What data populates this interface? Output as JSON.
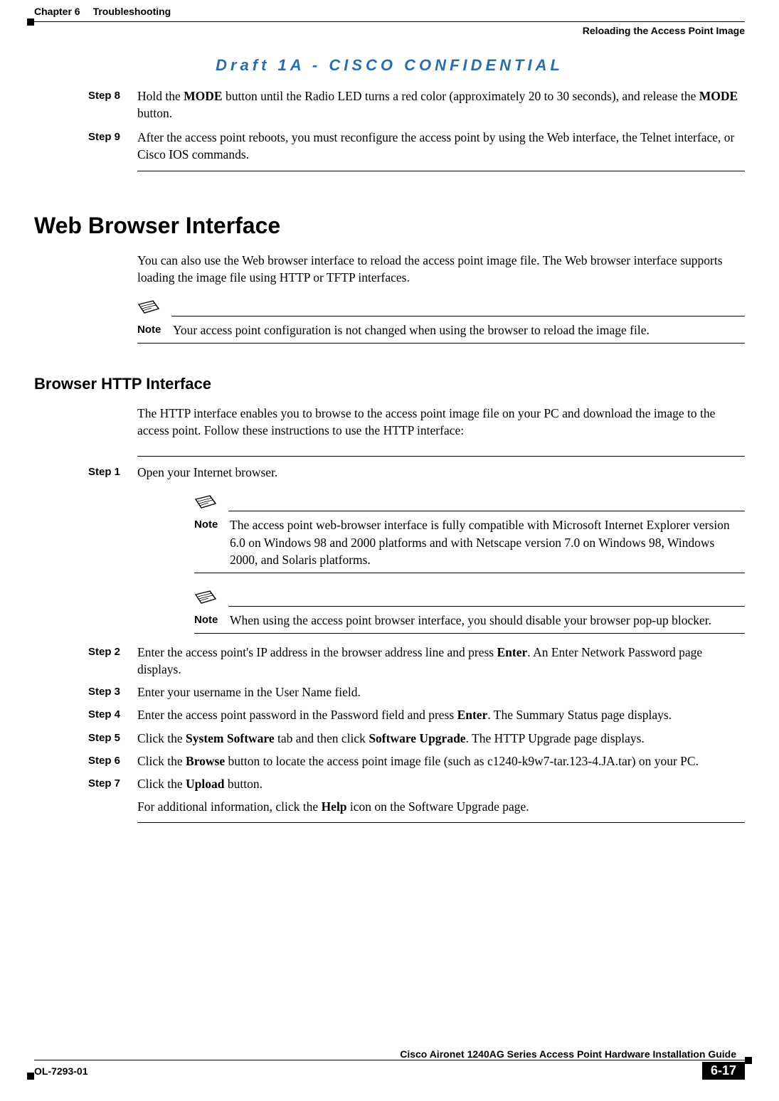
{
  "header": {
    "chapter": "Chapter 6",
    "chapter_title": "Troubleshooting",
    "section_right": "Reloading the Access Point Image"
  },
  "banner": "Draft 1A - CISCO CONFIDENTIAL",
  "top_steps": {
    "step8": {
      "label": "Step 8",
      "text_before_mode1": "Hold the ",
      "mode1": "MODE",
      "text_mid": " button until the Radio LED turns a red color (approximately 20 to 30 seconds), and release the ",
      "mode2": "MODE",
      "text_after": " button."
    },
    "step9": {
      "label": "Step 9",
      "text": "After the access point reboots, you must reconfigure the access point by using the Web interface, the Telnet interface, or Cisco IOS commands."
    }
  },
  "h2": "Web Browser Interface",
  "p_intro": "You can also use the Web browser interface to reload the access point image file. The Web browser interface supports loading the image file using HTTP or TFTP interfaces.",
  "note1": {
    "label": "Note",
    "text": "Your access point configuration is not changed when using the browser to reload the image file."
  },
  "h3": "Browser HTTP Interface",
  "p_http": "The HTTP interface enables you to browse to the access point image file on your PC and download the image to the access point. Follow these instructions to use the HTTP interface:",
  "http_steps": {
    "step1": {
      "label": "Step 1",
      "text": "Open your Internet browser."
    },
    "note2": {
      "label": "Note",
      "text": "The access point web-browser interface is fully compatible with Microsoft Internet Explorer version 6.0 on Windows 98 and 2000 platforms and with Netscape version 7.0 on Windows 98, Windows 2000, and Solaris platforms."
    },
    "note3": {
      "label": "Note",
      "text": "When using the access point browser interface, you should disable your browser pop-up blocker."
    },
    "step2": {
      "label": "Step 2",
      "pre": "Enter the access point's IP address in the browser address line and press ",
      "bold": "Enter",
      "post": ". An Enter Network Password page displays."
    },
    "step3": {
      "label": "Step 3",
      "text": "Enter your username in the User Name field."
    },
    "step4": {
      "label": "Step 4",
      "pre": "Enter the access point password in the Password field and press ",
      "bold": "Enter",
      "post": ". The Summary Status page displays."
    },
    "step5": {
      "label": "Step 5",
      "pre": "Click the ",
      "b1": "System Software",
      "mid": " tab and then click ",
      "b2": "Software Upgrade",
      "post": ". The HTTP Upgrade page displays."
    },
    "step6": {
      "label": "Step 6",
      "pre": "Click the ",
      "b1": "Browse",
      "post": " button to locate the access point image file (such as c1240-k9w7-tar.123-4.JA.tar) on your PC."
    },
    "step7": {
      "label": "Step 7",
      "pre": "Click the ",
      "b1": "Upload",
      "post": " button."
    },
    "tail": {
      "pre": "For additional information, click the ",
      "b1": "Help",
      "post": " icon on the Software Upgrade page."
    }
  },
  "footer": {
    "guide": "Cisco Aironet 1240AG Series Access Point Hardware Installation Guide",
    "docnum": "OL-7293-01",
    "pagenum": "6-17"
  }
}
